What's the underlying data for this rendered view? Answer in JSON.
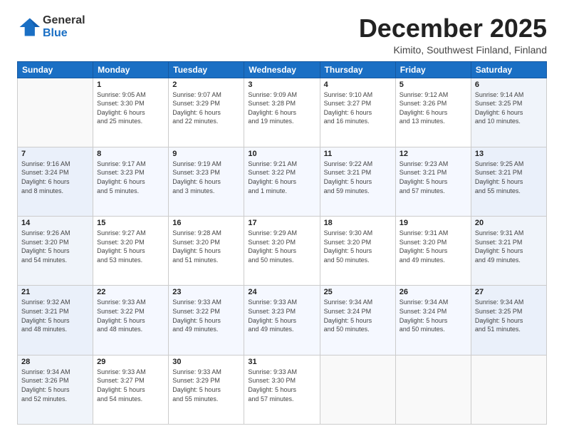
{
  "logo": {
    "general": "General",
    "blue": "Blue"
  },
  "title": "December 2025",
  "subtitle": "Kimito, Southwest Finland, Finland",
  "days_header": [
    "Sunday",
    "Monday",
    "Tuesday",
    "Wednesday",
    "Thursday",
    "Friday",
    "Saturday"
  ],
  "weeks": [
    [
      {
        "num": "",
        "info": ""
      },
      {
        "num": "1",
        "info": "Sunrise: 9:05 AM\nSunset: 3:30 PM\nDaylight: 6 hours\nand 25 minutes."
      },
      {
        "num": "2",
        "info": "Sunrise: 9:07 AM\nSunset: 3:29 PM\nDaylight: 6 hours\nand 22 minutes."
      },
      {
        "num": "3",
        "info": "Sunrise: 9:09 AM\nSunset: 3:28 PM\nDaylight: 6 hours\nand 19 minutes."
      },
      {
        "num": "4",
        "info": "Sunrise: 9:10 AM\nSunset: 3:27 PM\nDaylight: 6 hours\nand 16 minutes."
      },
      {
        "num": "5",
        "info": "Sunrise: 9:12 AM\nSunset: 3:26 PM\nDaylight: 6 hours\nand 13 minutes."
      },
      {
        "num": "6",
        "info": "Sunrise: 9:14 AM\nSunset: 3:25 PM\nDaylight: 6 hours\nand 10 minutes."
      }
    ],
    [
      {
        "num": "7",
        "info": "Sunrise: 9:16 AM\nSunset: 3:24 PM\nDaylight: 6 hours\nand 8 minutes."
      },
      {
        "num": "8",
        "info": "Sunrise: 9:17 AM\nSunset: 3:23 PM\nDaylight: 6 hours\nand 5 minutes."
      },
      {
        "num": "9",
        "info": "Sunrise: 9:19 AM\nSunset: 3:23 PM\nDaylight: 6 hours\nand 3 minutes."
      },
      {
        "num": "10",
        "info": "Sunrise: 9:21 AM\nSunset: 3:22 PM\nDaylight: 6 hours\nand 1 minute."
      },
      {
        "num": "11",
        "info": "Sunrise: 9:22 AM\nSunset: 3:21 PM\nDaylight: 5 hours\nand 59 minutes."
      },
      {
        "num": "12",
        "info": "Sunrise: 9:23 AM\nSunset: 3:21 PM\nDaylight: 5 hours\nand 57 minutes."
      },
      {
        "num": "13",
        "info": "Sunrise: 9:25 AM\nSunset: 3:21 PM\nDaylight: 5 hours\nand 55 minutes."
      }
    ],
    [
      {
        "num": "14",
        "info": "Sunrise: 9:26 AM\nSunset: 3:20 PM\nDaylight: 5 hours\nand 54 minutes."
      },
      {
        "num": "15",
        "info": "Sunrise: 9:27 AM\nSunset: 3:20 PM\nDaylight: 5 hours\nand 53 minutes."
      },
      {
        "num": "16",
        "info": "Sunrise: 9:28 AM\nSunset: 3:20 PM\nDaylight: 5 hours\nand 51 minutes."
      },
      {
        "num": "17",
        "info": "Sunrise: 9:29 AM\nSunset: 3:20 PM\nDaylight: 5 hours\nand 50 minutes."
      },
      {
        "num": "18",
        "info": "Sunrise: 9:30 AM\nSunset: 3:20 PM\nDaylight: 5 hours\nand 50 minutes."
      },
      {
        "num": "19",
        "info": "Sunrise: 9:31 AM\nSunset: 3:20 PM\nDaylight: 5 hours\nand 49 minutes."
      },
      {
        "num": "20",
        "info": "Sunrise: 9:31 AM\nSunset: 3:21 PM\nDaylight: 5 hours\nand 49 minutes."
      }
    ],
    [
      {
        "num": "21",
        "info": "Sunrise: 9:32 AM\nSunset: 3:21 PM\nDaylight: 5 hours\nand 48 minutes."
      },
      {
        "num": "22",
        "info": "Sunrise: 9:33 AM\nSunset: 3:22 PM\nDaylight: 5 hours\nand 48 minutes."
      },
      {
        "num": "23",
        "info": "Sunrise: 9:33 AM\nSunset: 3:22 PM\nDaylight: 5 hours\nand 49 minutes."
      },
      {
        "num": "24",
        "info": "Sunrise: 9:33 AM\nSunset: 3:23 PM\nDaylight: 5 hours\nand 49 minutes."
      },
      {
        "num": "25",
        "info": "Sunrise: 9:34 AM\nSunset: 3:24 PM\nDaylight: 5 hours\nand 50 minutes."
      },
      {
        "num": "26",
        "info": "Sunrise: 9:34 AM\nSunset: 3:24 PM\nDaylight: 5 hours\nand 50 minutes."
      },
      {
        "num": "27",
        "info": "Sunrise: 9:34 AM\nSunset: 3:25 PM\nDaylight: 5 hours\nand 51 minutes."
      }
    ],
    [
      {
        "num": "28",
        "info": "Sunrise: 9:34 AM\nSunset: 3:26 PM\nDaylight: 5 hours\nand 52 minutes."
      },
      {
        "num": "29",
        "info": "Sunrise: 9:33 AM\nSunset: 3:27 PM\nDaylight: 5 hours\nand 54 minutes."
      },
      {
        "num": "30",
        "info": "Sunrise: 9:33 AM\nSunset: 3:29 PM\nDaylight: 5 hours\nand 55 minutes."
      },
      {
        "num": "31",
        "info": "Sunrise: 9:33 AM\nSunset: 3:30 PM\nDaylight: 5 hours\nand 57 minutes."
      },
      {
        "num": "",
        "info": ""
      },
      {
        "num": "",
        "info": ""
      },
      {
        "num": "",
        "info": ""
      }
    ]
  ]
}
